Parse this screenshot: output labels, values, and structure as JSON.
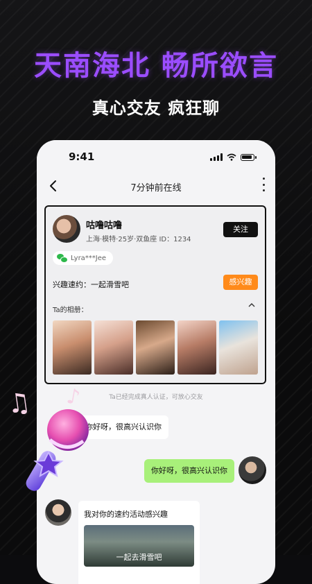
{
  "promo": {
    "headline": "天南海北 畅所欲言",
    "subhead": "真心交友 疯狂聊"
  },
  "status_bar": {
    "time": "9:41"
  },
  "nav": {
    "title": "7分钟前在线"
  },
  "profile": {
    "name": "咕噜咕噜",
    "info": "上海·模特·25岁·双鱼座 ID：1234",
    "follow_label": "关注",
    "wechat": "Lyra***Jee",
    "interest_text": "兴趣速约：一起滑雪吧",
    "interest_button": "感兴趣",
    "album_label": "Ta的相册：",
    "album_count": 5
  },
  "chat": {
    "notice": "Ta已经完成真人认证，可放心交友",
    "messages": [
      {
        "side": "left",
        "text": "你好呀，很高兴认识你"
      },
      {
        "side": "right",
        "text": "你好呀，很高兴认识你"
      },
      {
        "side": "left",
        "text": "我对你的速约活动感兴趣"
      }
    ],
    "invite_image_label": "一起去滑雪吧"
  },
  "colors": {
    "headline": "#9b4dff",
    "follow_button": "#111111",
    "interest_button": "#ff8a1a",
    "outgoing_bubble": "#a8f07a"
  }
}
